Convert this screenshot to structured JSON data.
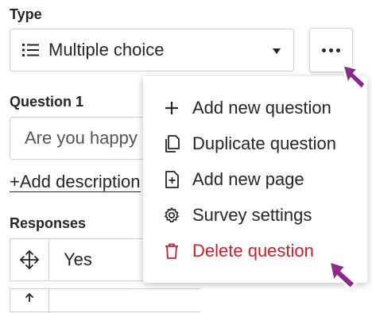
{
  "type_section": {
    "label": "Type",
    "selected_value": "Multiple choice",
    "list_icon": "list-icon",
    "more_button_icon": "more-horizontal-icon"
  },
  "question_section": {
    "label": "Question 1",
    "input_value": "Are you happy"
  },
  "add_description": {
    "plus": "+",
    "label": "Add description"
  },
  "responses_section": {
    "label": "Responses",
    "items": [
      {
        "text": "Yes"
      }
    ]
  },
  "menu": {
    "items": [
      {
        "label": "Add new question",
        "icon": "plus-icon"
      },
      {
        "label": "Duplicate question",
        "icon": "duplicate-icon"
      },
      {
        "label": "Add new page",
        "icon": "add-page-icon"
      },
      {
        "label": "Survey settings",
        "icon": "gear-icon"
      },
      {
        "label": "Delete question",
        "icon": "trash-icon",
        "color": "#c8202c"
      }
    ]
  },
  "colors": {
    "danger": "#c8202c",
    "pointer_arrow": "#8b2a8a",
    "border": "#cfcfcf"
  }
}
